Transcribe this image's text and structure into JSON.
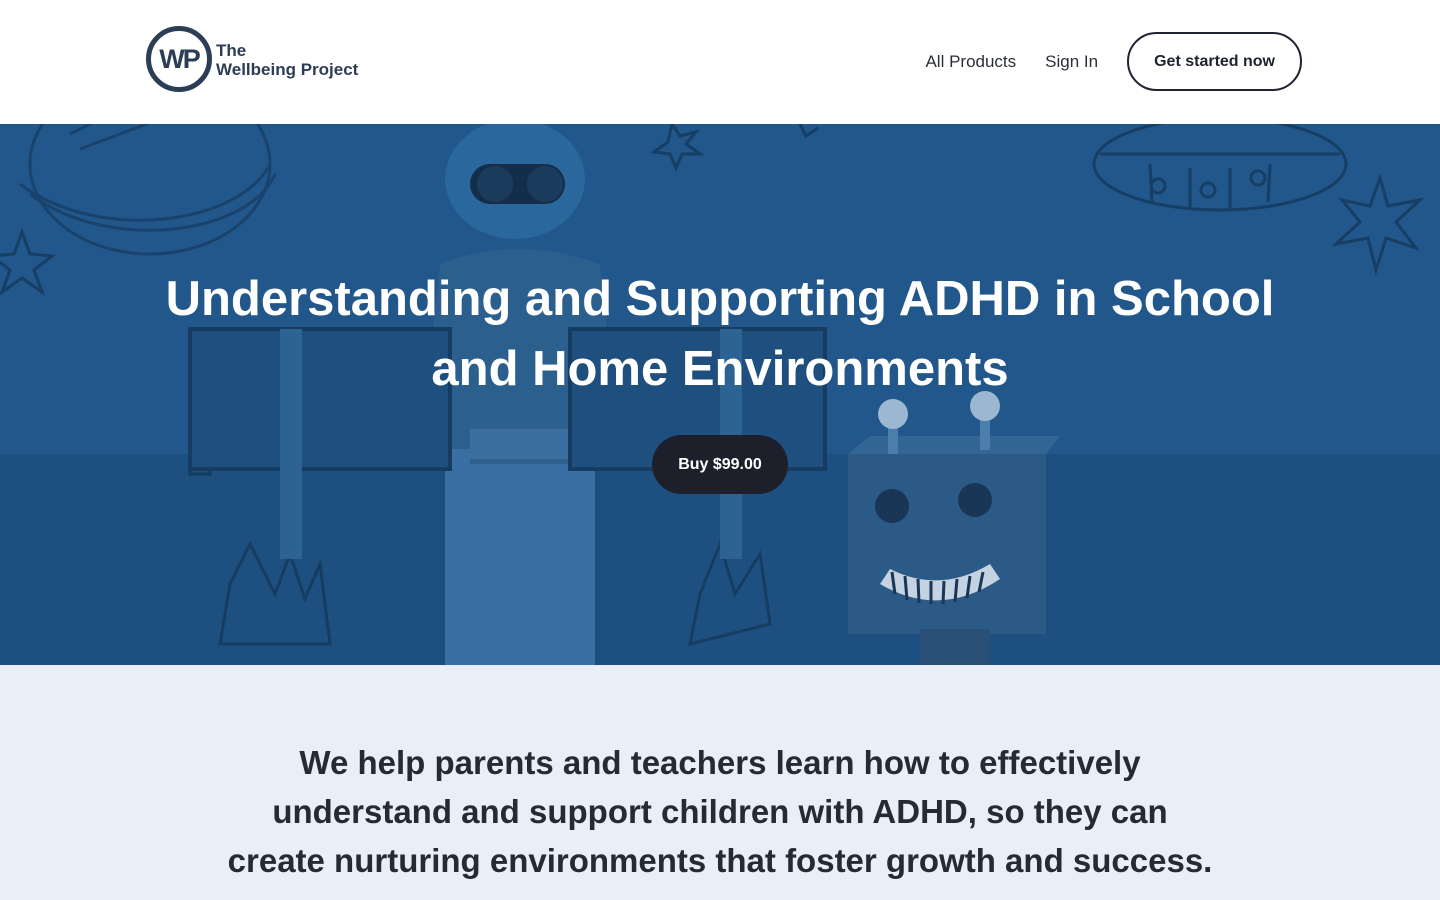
{
  "header": {
    "logo_mark": "WP",
    "logo_line1": "The",
    "logo_line2": "Wellbeing Project",
    "nav": [
      {
        "label": "All Products"
      },
      {
        "label": "Sign In"
      }
    ],
    "cta_label": "Get started now"
  },
  "hero": {
    "title_line1": "Understanding and Supporting ADHD in School",
    "title_line2": "and Home Environments",
    "buy_label": "Buy $99.00",
    "image": "child-with-aviator-goggles-and-robot-drawings"
  },
  "intro": {
    "line1": "We help parents and teachers learn how to effectively",
    "line2": "understand and support children with ADHD, so they can",
    "line3": "create nurturing environments that foster growth and success."
  },
  "colors": {
    "brand": "#2c3e55",
    "hero_overlay": "#1f5282",
    "button_dark": "#1d1f2a",
    "intro_bg": "#e9eef7"
  }
}
